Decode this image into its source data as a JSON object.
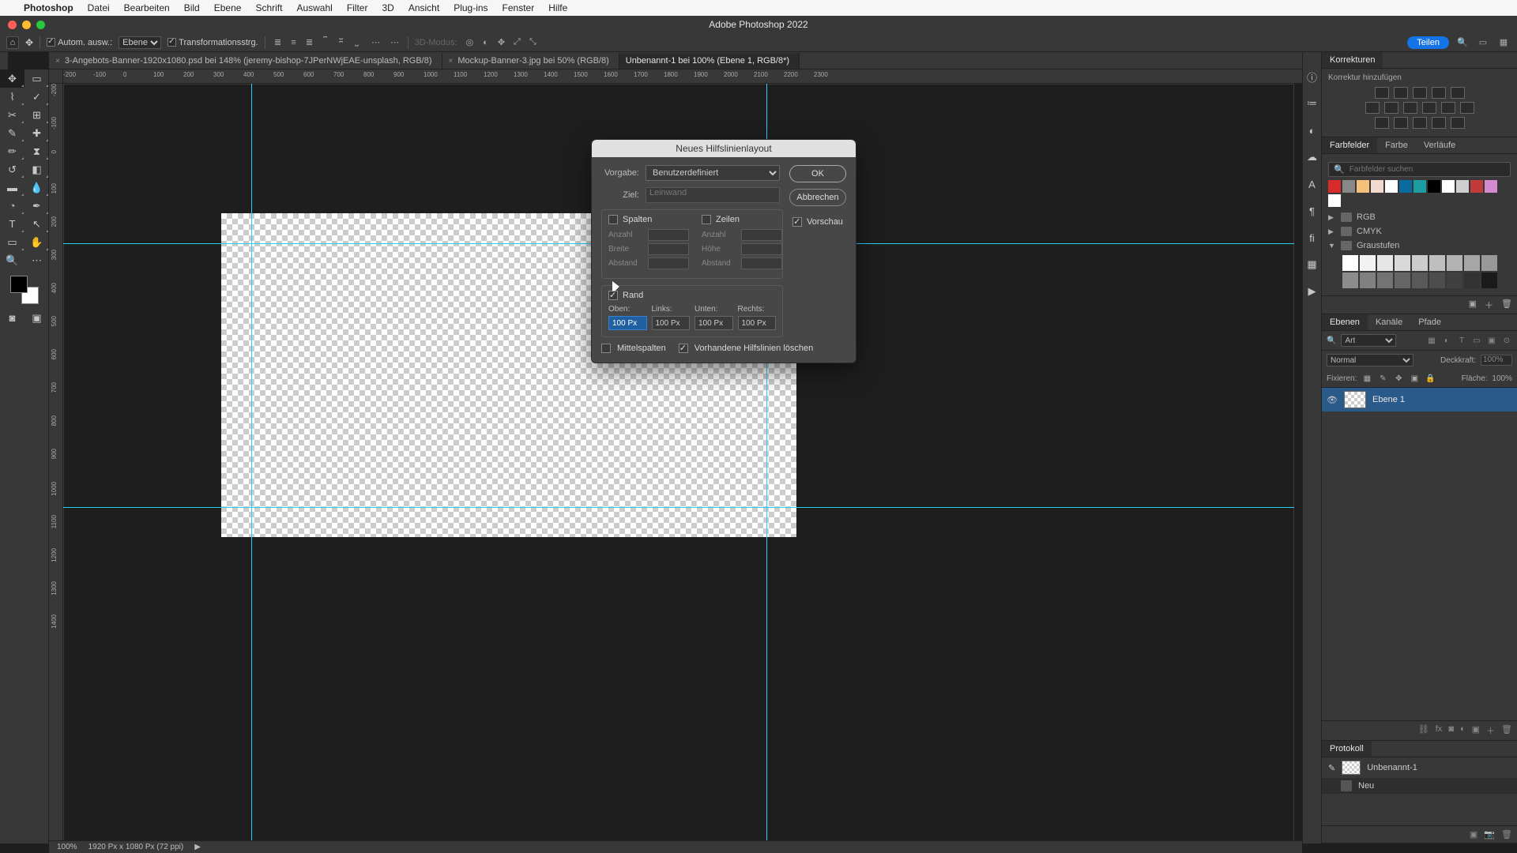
{
  "menubar": {
    "app": "Photoshop",
    "items": [
      "Datei",
      "Bearbeiten",
      "Bild",
      "Ebene",
      "Schrift",
      "Auswahl",
      "Filter",
      "3D",
      "Ansicht",
      "Plug-ins",
      "Fenster",
      "Hilfe"
    ]
  },
  "window": {
    "title": "Adobe Photoshop 2022"
  },
  "options": {
    "auto_select": "Autom. ausw.:",
    "layer_kind": "Ebene",
    "transform": "Transformationsstrg.",
    "mode3d": "3D-Modus:",
    "share": "Teilen"
  },
  "tabs": [
    {
      "label": "3-Angebots-Banner-1920x1080.psd bei 148% (jeremy-bishop-7JPerNWjEAE-unsplash, RGB/8)",
      "active": false
    },
    {
      "label": "Mockup-Banner-3.jpg bei 50% (RGB/8)",
      "active": false
    },
    {
      "label": "Unbenannt-1 bei 100% (Ebene 1, RGB/8*)",
      "active": true
    }
  ],
  "ruler_h": [
    "-200",
    "-100",
    "0",
    "100",
    "200",
    "300",
    "400",
    "500",
    "600",
    "700",
    "800",
    "900",
    "1000",
    "1100",
    "1200",
    "1300",
    "1400",
    "1500",
    "1600",
    "1700",
    "1800",
    "1900",
    "2000",
    "2100",
    "2200",
    "2300"
  ],
  "ruler_v": [
    "-200",
    "-100",
    "0",
    "100",
    "200",
    "300",
    "400",
    "500",
    "600",
    "700",
    "800",
    "900",
    "1000",
    "1100",
    "1200",
    "1300",
    "1400"
  ],
  "status": {
    "zoom": "100%",
    "dims": "1920 Px x 1080 Px (72 ppi)"
  },
  "panels": {
    "korrekturen": {
      "tab": "Korrekturen",
      "add": "Korrektur hinzufügen"
    },
    "swatches": {
      "tabs": [
        "Farbfelder",
        "Farbe",
        "Verläufe"
      ],
      "search_ph": "Farbfelder suchen",
      "folders": [
        "RGB",
        "CMYK",
        "Graustufen"
      ],
      "row_colors": [
        "#d72b2b",
        "#f7d矣",
        "#f4c07a",
        "#f2d9cf",
        "#ffffff",
        "#0b6aa0",
        "#1a9ea3",
        "#000000",
        "#ffffff",
        "#cfcfcf",
        "#c23b3b",
        "#d48bd0",
        "#ffffff"
      ],
      "grays": [
        "#ffffff",
        "#f2f2f2",
        "#e6e6e6",
        "#d9d9d9",
        "#cccccc",
        "#bfbfbf",
        "#b3b3b3",
        "#a6a6a6",
        "#999999",
        "#8c8c8c",
        "#808080",
        "#737373",
        "#666666",
        "#595959",
        "#4d4d4d",
        "#404040",
        "#333333",
        "#1a1a1a"
      ]
    },
    "layers": {
      "tabs": [
        "Ebenen",
        "Kanäle",
        "Pfade"
      ],
      "kind": "Art",
      "blend": "Normal",
      "opacity_lbl": "Deckkraft:",
      "opacity": "100%",
      "lock_lbl": "Fixieren:",
      "fill_lbl": "Fläche:",
      "fill": "100%",
      "layer1": "Ebene 1"
    },
    "history": {
      "tab": "Protokoll",
      "doc": "Unbenannt-1",
      "step": "Neu"
    }
  },
  "dialog": {
    "title": "Neues Hilfslinienlayout",
    "preset_lbl": "Vorgabe:",
    "preset": "Benutzerdefiniert",
    "target_lbl": "Ziel:",
    "target": "Leinwand",
    "ok": "OK",
    "cancel": "Abbrechen",
    "preview": "Vorschau",
    "columns": "Spalten",
    "rows": "Zeilen",
    "count": "Anzahl",
    "width": "Breite",
    "height": "Höhe",
    "gutter": "Abstand",
    "margin": "Rand",
    "top": "Oben:",
    "left": "Links:",
    "bottom": "Unten:",
    "right": "Rechts:",
    "val_top": "100 Px",
    "val_left": "100 Px",
    "val_bottom": "100 Px",
    "val_right": "100 Px",
    "center_cols": "Mittelspalten",
    "clear_guides": "Vorhandene Hilfslinien löschen"
  }
}
